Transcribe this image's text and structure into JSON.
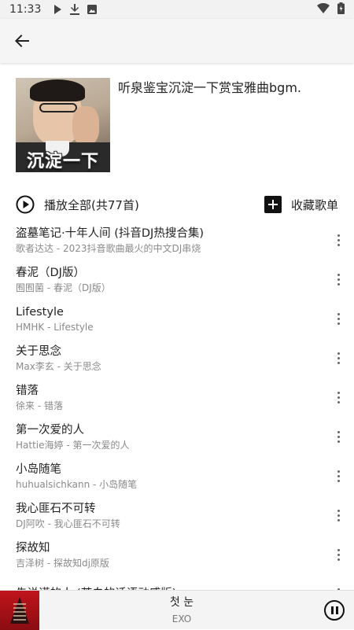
{
  "status_bar": {
    "time": "11:33"
  },
  "playlist": {
    "title": "听泉鉴宝沉淀一下赏宝雅曲bgm.",
    "cover_caption": "沉淀一下"
  },
  "controls": {
    "play_all_label": "播放全部(共77首)",
    "collect_label": "收藏歌单"
  },
  "songs": [
    {
      "title": "盗墓笔记·十年人间 (抖音DJ热搜合集)",
      "subtitle": "歌者达达 - 2023抖音歌曲最火的中文DJ串烧"
    },
    {
      "title": "春泥（DJ版）",
      "subtitle": "囿囿菌 - 春泥（DJ版）"
    },
    {
      "title": "Lifestyle",
      "subtitle": "HMHK - Lifestyle"
    },
    {
      "title": "关于思念",
      "subtitle": "Max李玄 - 关于思念"
    },
    {
      "title": "错落",
      "subtitle": "徐来 - 错落"
    },
    {
      "title": "第一次爱的人",
      "subtitle": "Hattie海婷 - 第一次爱的人"
    },
    {
      "title": "小岛随笔",
      "subtitle": "huhualsichkann - 小岛随笔"
    },
    {
      "title": "我心匪石不可转",
      "subtitle": "DJ阿吹 - 我心匪石不可转"
    },
    {
      "title": "探故知",
      "subtitle": "吉泽树 - 探故知dj原版"
    },
    {
      "title": "先说谎的人 (苍白的话语动感版)",
      "subtitle": ""
    }
  ],
  "now_playing": {
    "song": "첫 눈",
    "artist": "EXO"
  }
}
